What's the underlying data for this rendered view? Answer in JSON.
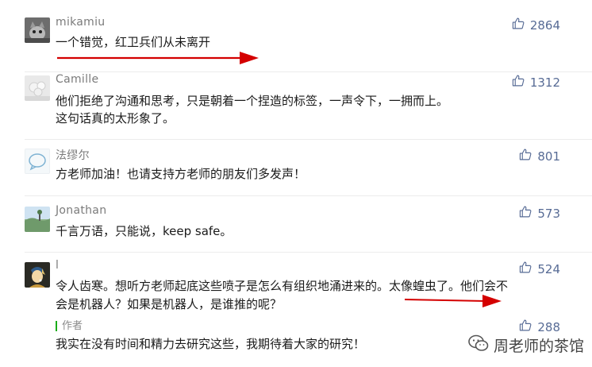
{
  "comments": [
    {
      "name": "mikamiu",
      "lines": [
        "一个错觉，红卫兵们从未离开"
      ],
      "likes": "2864",
      "avatar": "cat-photo"
    },
    {
      "name": "Camille",
      "lines": [
        "他们拒绝了沟通和思考，只是朝着一个捏造的标签，一声令下，一拥而上。",
        "这句话真的太形象了。"
      ],
      "likes": "1312",
      "avatar": "flower-photo"
    },
    {
      "name": "法缪尔",
      "lines": [
        "方老师加油！也请支持方老师的朋友们多发声！"
      ],
      "likes": "801",
      "avatar": "speech-bubble"
    },
    {
      "name": "Jonathan",
      "lines": [
        "千言万语，只能说，keep safe。"
      ],
      "likes": "573",
      "avatar": "landscape-photo"
    },
    {
      "name": "l",
      "lines": [
        "令人齿寒。想听方老师起底这些喷子是怎么有组织地涌进来的。太像蝗虫了。他们会不",
        "会是机器人？如果是机器人，是谁推的呢？"
      ],
      "likes": "524",
      "avatar": "pearl-earring-painting",
      "reply": {
        "tag": "作者",
        "text": "我实在没有时间和精力去研究这些，我期待着大家的研究！",
        "likes": "288"
      }
    }
  ],
  "watermark": "周老师的茶馆",
  "colors": {
    "like": "#576b95",
    "arrow": "#d40000",
    "author": "#1aad19"
  }
}
